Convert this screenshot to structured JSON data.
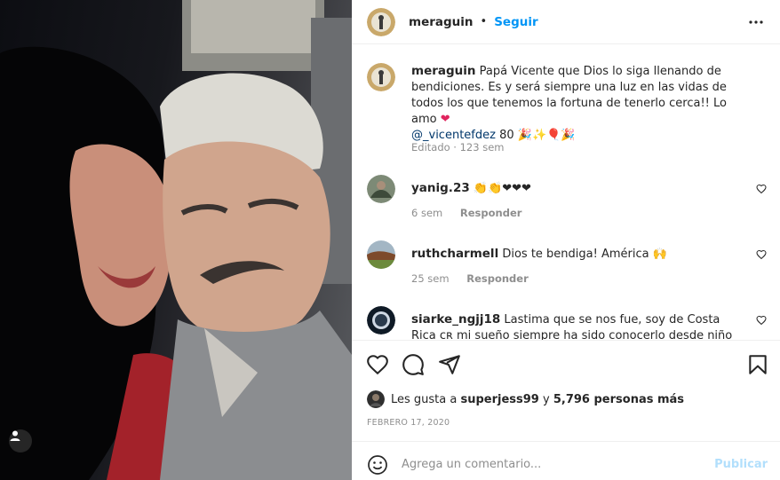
{
  "post": {
    "username": "meraguin",
    "separator": "•",
    "follow_label": "Seguir",
    "caption": {
      "username": "meraguin",
      "text": "Papá Vicente que Dios lo siga llenando de bendiciones. Es y será siempre una luz en las vidas de todos los que tenemos la fortuna de tenerlo cerca!! Lo amo",
      "mention": "@_vicentefdez",
      "suffix": "80",
      "edited": "Editado · 123 sem"
    },
    "comments": [
      {
        "username": "yanig.23",
        "text": "👏👏❤❤❤",
        "time": "6 sem",
        "reply_label": "Responder"
      },
      {
        "username": "ruthcharmell",
        "text": "Dios te bendiga! América 🙌",
        "time": "25 sem",
        "reply_label": "Responder"
      },
      {
        "username": "siarke_ngjj18",
        "text": "Lastima que se nos fue, soy de Costa Rica ᴄʀ mi sueño siempre ha sido conocerlo desde niño pero ya",
        "time": "",
        "reply_label": ""
      }
    ],
    "likes": {
      "prefix": "Les gusta a",
      "user": "superjess99",
      "middle": "y",
      "count_text": "5,796 personas más"
    },
    "date": "FEBRERO 17, 2020",
    "add_comment": {
      "placeholder": "Agrega un comentario...",
      "post_label": "Publicar"
    }
  },
  "icons": {
    "more": "more-dots-icon",
    "like": "heart-icon",
    "comment": "comment-bubble-icon",
    "share": "paper-plane-icon",
    "save": "bookmark-icon",
    "emoji": "smiley-icon",
    "tag": "user-tag-icon"
  },
  "colors": {
    "accent": "#0095f6",
    "post_disabled": "#b2dffc",
    "muted": "#8e8e8e",
    "text": "#262626"
  }
}
